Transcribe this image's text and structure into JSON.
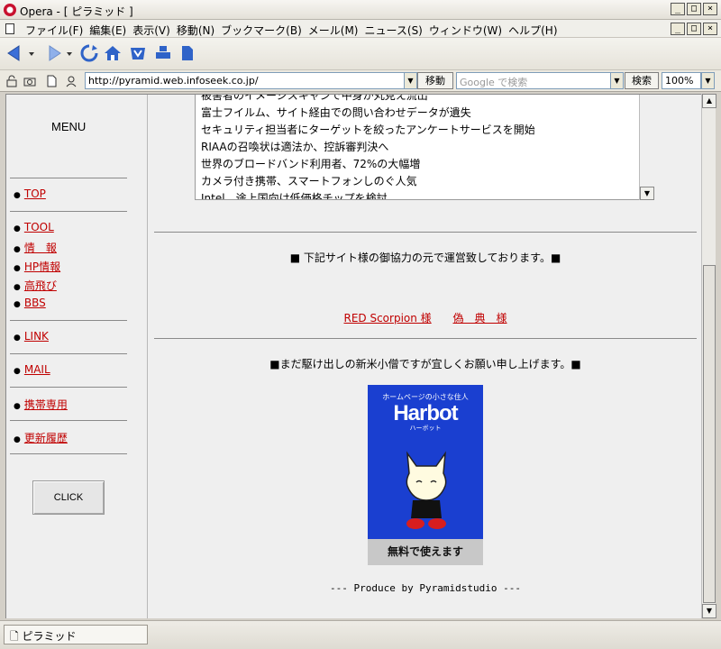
{
  "window": {
    "title": "Opera - [ ピラミッド ]",
    "minimize": "_",
    "maximize": "□",
    "close": "×"
  },
  "menubar": {
    "items": [
      "ファイル(F)",
      "編集(E)",
      "表示(V)",
      "移動(N)",
      "ブックマーク(B)",
      "メール(M)",
      "ニュース(S)",
      "ウィンドウ(W)",
      "ヘルプ(H)"
    ]
  },
  "toolbar": {
    "icons": [
      "back-icon",
      "forward-icon",
      "reload-icon",
      "home-icon",
      "hotlist-icon",
      "print-icon",
      "document-icon"
    ]
  },
  "address": {
    "url": "http://pyramid.web.infoseek.co.jp/",
    "go_label": "移動",
    "search_placeholder": "Google で検索",
    "search_label": "検索",
    "zoom": "100%"
  },
  "sidebar": {
    "menu_title": "MENU",
    "items": {
      "top": "TOP",
      "tool": "TOOL",
      "info": "情　報",
      "hpinfo": "HP情報",
      "takatobi": "高飛び",
      "bbs": "BBS",
      "link": "LINK",
      "mail": "MAIL",
      "mobile": "携帯専用",
      "history": "更新履歴"
    },
    "click_label": "CLICK"
  },
  "news": {
    "items": [
      "被害者のイメージスキャンで中身が丸見え流出",
      "富士フイルム、サイト経由での問い合わせデータが遺失",
      "セキュリティ担当者にターゲットを絞ったアンケートサービスを開始",
      "RIAAの召喚状は適法か、控訴審判決へ",
      "世界のブロードバンド利用者、72%の大幅増",
      "カメラ付き携帯、スマートフォンしのぐ人気",
      "Intel、途上国向け低価格チップを検討"
    ]
  },
  "main": {
    "sponsor_notice": "■ 下記サイト様の御協力の元で運営致しております。■",
    "sponsor_link1": "RED Scorpion 様",
    "sponsor_link2": "偽　典　様",
    "newbie_notice": "■まだ駆け出しの新米小僧ですが宜しくお願い申し上げます。■",
    "produce": "--- Produce by Pyramidstudio ---"
  },
  "banner": {
    "tagline": "ホームページの小さな住人",
    "logo": "Harbot",
    "kana": "ハーボット",
    "footer": "無料で使えます",
    "bg_color": "#1a3fd0"
  },
  "status": {
    "tab_label": "ピラミッド"
  },
  "colors": {
    "link": "#c00000",
    "content_bg": "#efefef"
  }
}
